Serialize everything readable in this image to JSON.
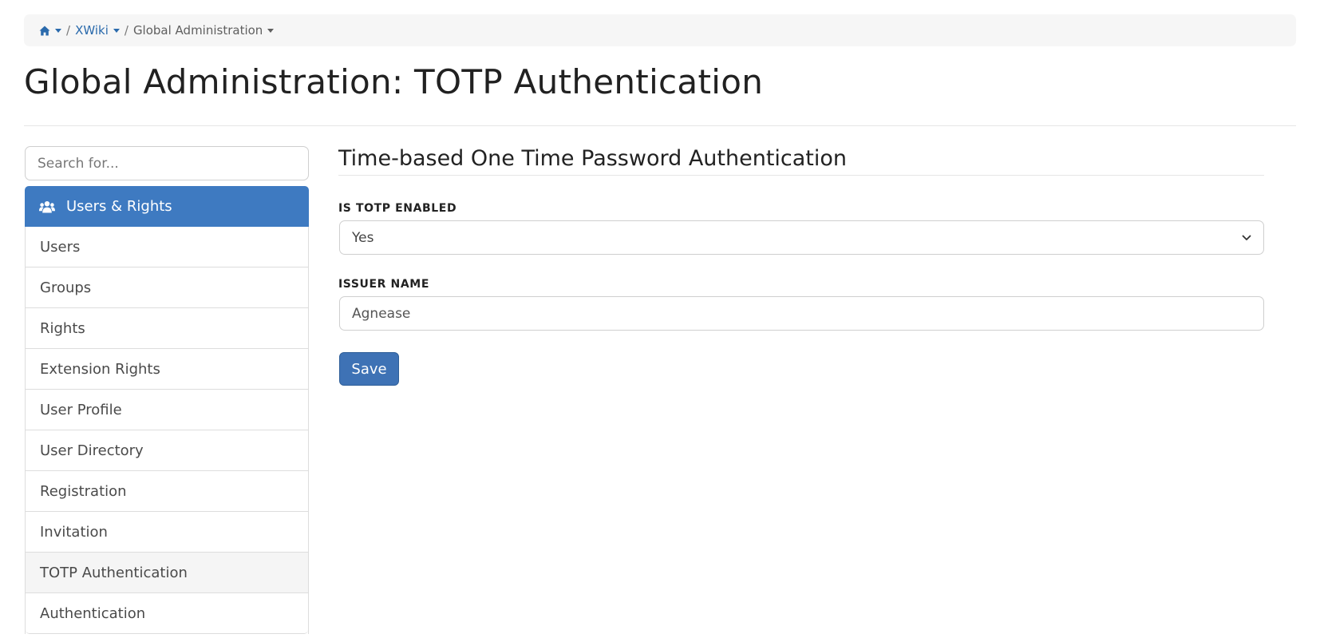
{
  "breadcrumb": {
    "home_icon": "home-icon",
    "wiki_label": "XWiki",
    "current_label": "Global Administration",
    "separator": "/"
  },
  "page_title": "Global Administration: TOTP Authentication",
  "sidebar": {
    "search_placeholder": "Search for...",
    "header": {
      "icon": "users-icon",
      "label": "Users & Rights"
    },
    "items": [
      {
        "label": "Users",
        "active": false
      },
      {
        "label": "Groups",
        "active": false
      },
      {
        "label": "Rights",
        "active": false
      },
      {
        "label": "Extension Rights",
        "active": false
      },
      {
        "label": "User Profile",
        "active": false
      },
      {
        "label": "User Directory",
        "active": false
      },
      {
        "label": "Registration",
        "active": false
      },
      {
        "label": "Invitation",
        "active": false
      },
      {
        "label": "TOTP Authentication",
        "active": true
      },
      {
        "label": "Authentication",
        "active": false
      }
    ]
  },
  "main": {
    "section_title": "Time-based One Time Password Authentication",
    "totp_enabled": {
      "label": "IS TOTP ENABLED",
      "value": "Yes"
    },
    "issuer_name": {
      "label": "ISSUER NAME",
      "value": "Agnease"
    },
    "save_label": "Save"
  },
  "colors": {
    "accent": "#3e7ac1",
    "link": "#2a6aac",
    "button": "#3e72b5"
  }
}
